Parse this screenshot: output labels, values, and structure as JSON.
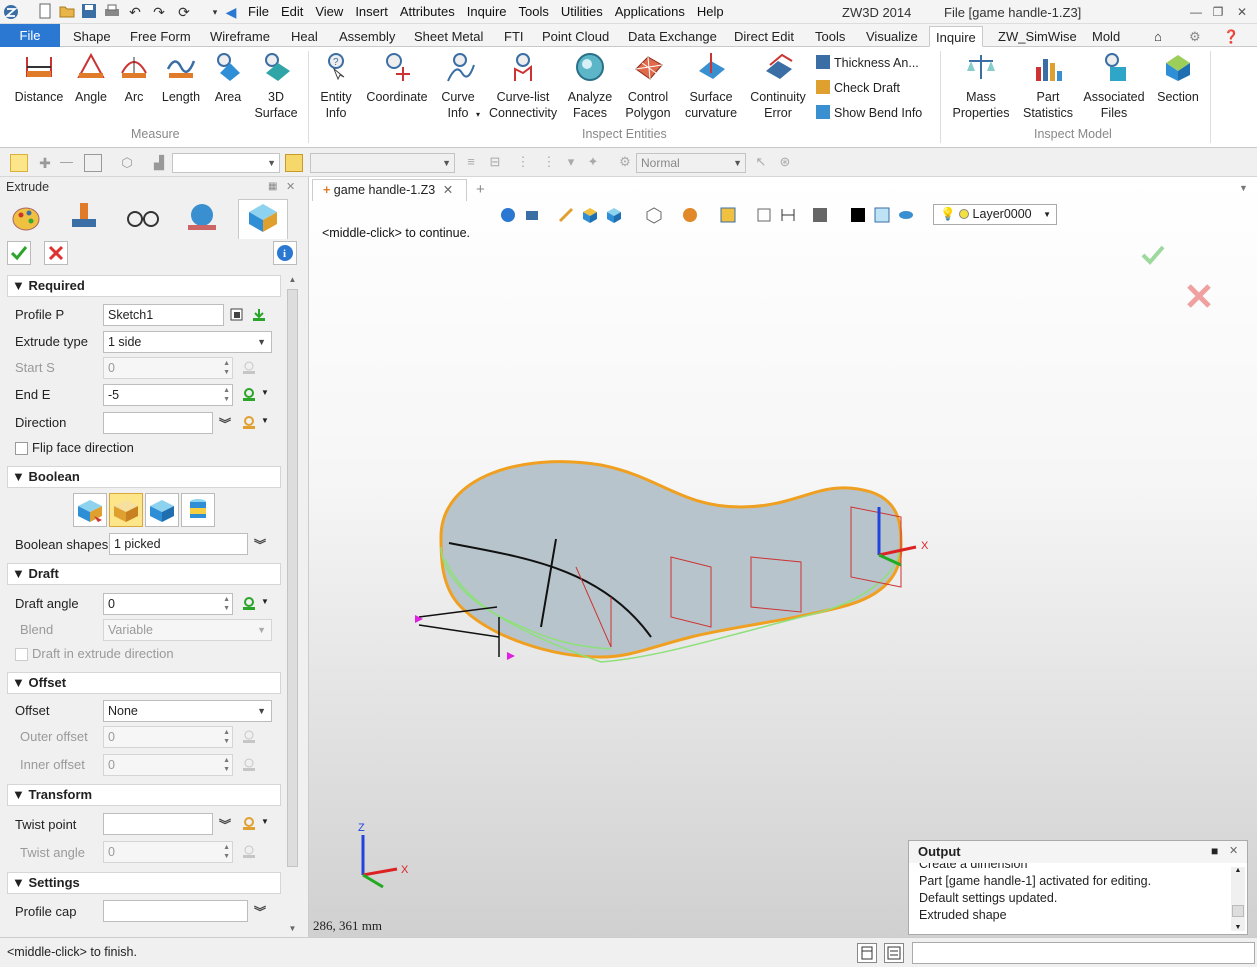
{
  "titlebar": {
    "menu": [
      "File",
      "Edit",
      "View",
      "Insert",
      "Attributes",
      "Inquire",
      "Tools",
      "Utilities",
      "Applications",
      "Help"
    ],
    "app_title": "ZW3D 2014",
    "file_title": "File [game handle-1.Z3]"
  },
  "ribbon_tabs": [
    "File",
    "Shape",
    "Free Form",
    "Wireframe",
    "Heal",
    "Assembly",
    "Sheet Metal",
    "FTI",
    "Point Cloud",
    "Data Exchange",
    "Direct Edit",
    "Tools",
    "Visualize",
    "Inquire",
    "ZW_SimWise",
    "Mold"
  ],
  "active_tab": "Inquire",
  "ribbon": {
    "measure": {
      "group": "Measure",
      "buttons": [
        "Distance",
        "Angle",
        "Arc",
        "Length",
        "Area",
        "3D Surface"
      ]
    },
    "inspect_entities": {
      "group": "Inspect Entities",
      "buttons": [
        "Entity Info",
        "Coordinate",
        "Curve Info",
        "Curve-list Connectivity",
        "Analyze Faces",
        "Control Polygon",
        "Surface curvature",
        "Continuity Error"
      ],
      "small": [
        "Thickness An...",
        "Check Draft",
        "Show Bend Info"
      ]
    },
    "inspect_model": {
      "group": "Inspect Model",
      "buttons": [
        "Mass Properties",
        "Part Statistics",
        "Associated Files",
        "Section"
      ]
    }
  },
  "toolbar2": {
    "normal_combo": "Normal"
  },
  "panel": {
    "title": "Extrude",
    "required": {
      "header": "Required",
      "profile_label": "Profile P",
      "profile_value": "Sketch1",
      "extrude_type_label": "Extrude type",
      "extrude_type_value": "1 side",
      "start_label": "Start S",
      "start_value": "0",
      "end_label": "End E",
      "end_value": "-5",
      "direction_label": "Direction",
      "direction_value": "",
      "flip_label": "Flip face direction"
    },
    "boolean": {
      "header": "Boolean",
      "shapes_label": "Boolean shapes",
      "shapes_value": "1 picked"
    },
    "draft": {
      "header": "Draft",
      "angle_label": "Draft angle",
      "angle_value": "0",
      "blend_label": "Blend",
      "blend_value": "Variable",
      "dir_label": "Draft in extrude direction"
    },
    "offset": {
      "header": "Offset",
      "offset_label": "Offset",
      "offset_value": "None",
      "outer_label": "Outer offset",
      "outer_value": "0",
      "inner_label": "Inner offset",
      "inner_value": "0"
    },
    "transform": {
      "header": "Transform",
      "twist_point_label": "Twist point",
      "twist_point_value": "",
      "twist_angle_label": "Twist angle",
      "twist_angle_value": "0"
    },
    "settings": {
      "header": "Settings",
      "profile_cap_label": "Profile cap",
      "profile_cap_value": ""
    }
  },
  "viewport": {
    "tab_label": "game handle-1.Z3",
    "prompt": "<middle-click> to continue.",
    "layer": "Layer0000",
    "coords": "286, 361 mm",
    "axis_z": "Z",
    "axis_x": "X"
  },
  "output": {
    "title": "Output",
    "lines": [
      "Create a dimension",
      "Part [game handle-1] activated for editing.",
      "Default settings updated.",
      "Extruded shape"
    ]
  },
  "status": {
    "text": "<middle-click> to finish."
  },
  "colors": {
    "file_tab": "#2b78d2",
    "accept": "#2aa52a",
    "cancel": "#e03030",
    "model_outline": "#f0a020"
  }
}
